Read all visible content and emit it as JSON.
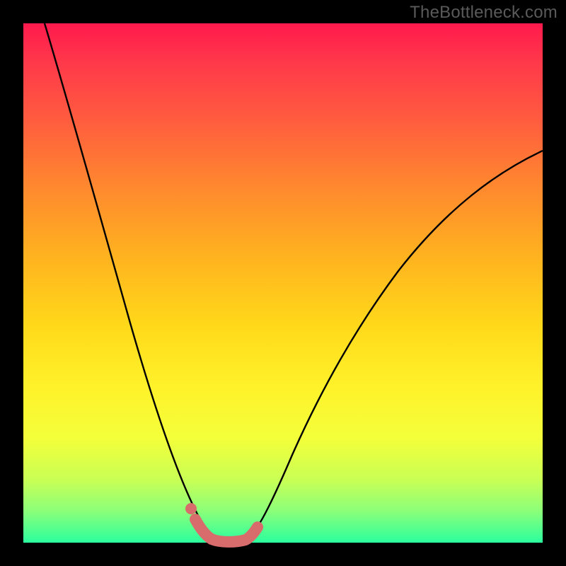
{
  "watermark": "TheBottleneck.com",
  "colors": {
    "frame": "#000000",
    "gradient_top": "#ff1a4d",
    "gradient_bottom": "#2bff9e",
    "curve": "#000000",
    "highlight": "#d86b6b"
  },
  "chart_data": {
    "type": "line",
    "title": "",
    "xlabel": "",
    "ylabel": "",
    "xlim": [
      0,
      100
    ],
    "ylim": [
      0,
      100
    ],
    "grid": false,
    "legend": false,
    "notes": "Two curve segments form a V/U shaped bottleneck profile. y=0 at bottom (green), y=100 at top (red). x increases left→right. A short salmon-colored thick segment marks the flat bottom of the U around x≈34–43.",
    "series": [
      {
        "name": "left-branch",
        "x": [
          4,
          6,
          8,
          10,
          12,
          14,
          16,
          18,
          20,
          22,
          24,
          26,
          28,
          30,
          32,
          34,
          36
        ],
        "y": [
          100,
          92,
          84,
          76,
          68,
          60,
          52,
          44,
          37,
          30,
          24,
          18,
          13,
          8,
          4,
          1.5,
          0.5
        ]
      },
      {
        "name": "right-branch",
        "x": [
          42,
          44,
          46,
          48,
          50,
          52,
          55,
          58,
          62,
          66,
          70,
          75,
          80,
          85,
          90,
          95,
          100
        ],
        "y": [
          0.5,
          2,
          5,
          9,
          14,
          19,
          26,
          32,
          39,
          45,
          50,
          56,
          61,
          65,
          69,
          72,
          75
        ]
      },
      {
        "name": "bottom-highlight",
        "style": "thick-dots",
        "color": "#d86b6b",
        "x": [
          32,
          34,
          36,
          38,
          40,
          42,
          44
        ],
        "y": [
          4,
          1.5,
          0.6,
          0.4,
          0.4,
          0.6,
          1.8
        ]
      }
    ]
  }
}
